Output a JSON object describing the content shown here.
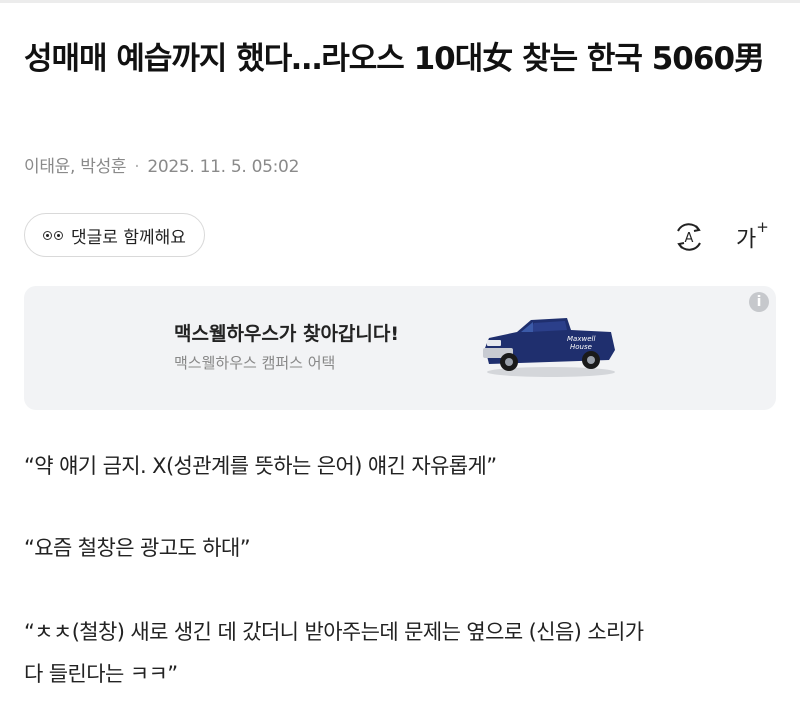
{
  "article": {
    "headline": "성매매 예습까지 했다…라오스 10대女 찾는 한국 5060男",
    "authors": "이태윤, 박성훈",
    "separator": "·",
    "date": "2025. 11. 5. 05:02"
  },
  "toolbar": {
    "comment_label": "댓글로 함께해요",
    "tts_icon": "text-to-speech-icon",
    "font_size_label": "가",
    "font_size_plus": "+"
  },
  "ad": {
    "title": "맥스웰하우스가 찾아갑니다!",
    "subtitle": "맥스웰하우스 캠퍼스 어택",
    "info_glyph": "i",
    "truck_text_1": "Maxwell",
    "truck_text_2": "House",
    "truck_color": "#1f2f6e"
  },
  "body": {
    "paragraphs": [
      "“약 얘기 금지. X(성관계를 뜻하는 은어) 얘긴 자유롭게”",
      "“요즘 철창은 광고도 하대”",
      "“ㅊㅊ(철창) 새로 생긴 데 갔더니 받아주는데 문제는 옆으로 (신음) 소리가",
      "다 들린다는 ㅋㅋ”"
    ]
  }
}
